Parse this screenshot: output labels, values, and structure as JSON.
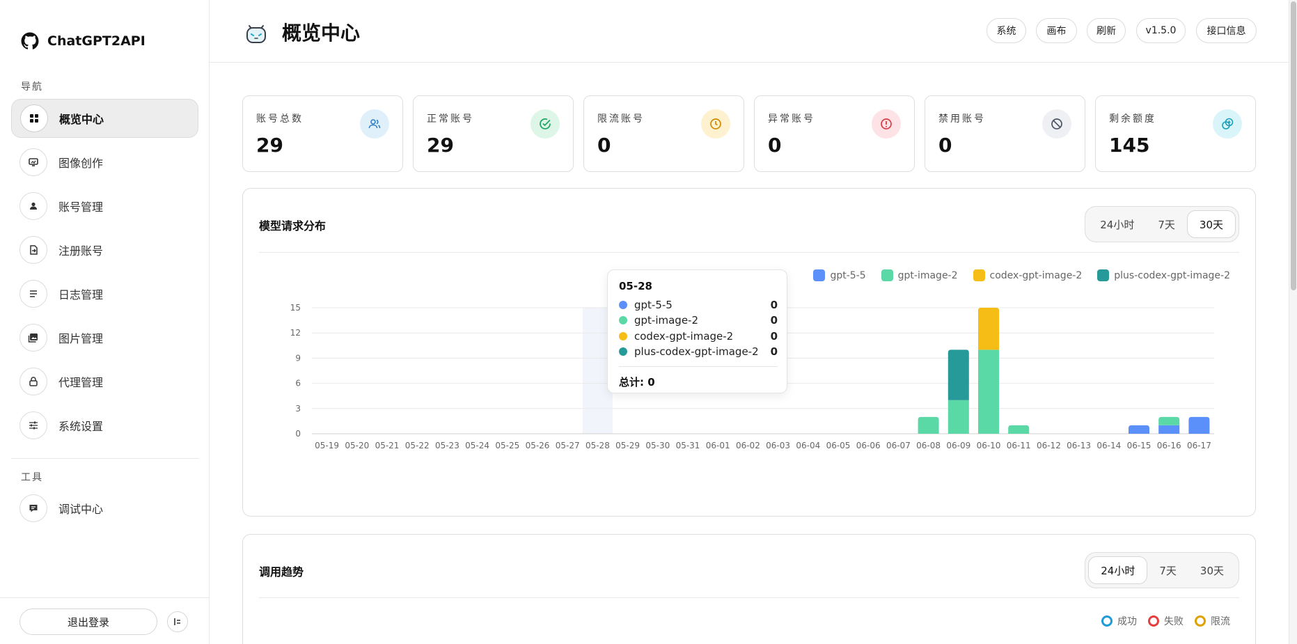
{
  "app": {
    "name": "ChatGPT2API"
  },
  "sidebar": {
    "nav_section": "导航",
    "items": [
      {
        "label": "概览中心",
        "active": true
      },
      {
        "label": "图像创作"
      },
      {
        "label": "账号管理"
      },
      {
        "label": "注册账号"
      },
      {
        "label": "日志管理"
      },
      {
        "label": "图片管理"
      },
      {
        "label": "代理管理"
      },
      {
        "label": "系统设置"
      }
    ],
    "tools_section": "工具",
    "tools": [
      {
        "label": "调试中心"
      }
    ],
    "logout": "退出登录"
  },
  "header": {
    "title": "概览中心",
    "buttons": [
      "系统",
      "画布",
      "刷新",
      "v1.5.0",
      "接口信息"
    ]
  },
  "stats": [
    {
      "label": "账号总数",
      "value": "29",
      "icon": "users-icon",
      "color": "#2f7fc6",
      "bg": "#dff0fb"
    },
    {
      "label": "正常账号",
      "value": "29",
      "icon": "check-circle-icon",
      "color": "#1fa463",
      "bg": "#ddf6e8"
    },
    {
      "label": "限流账号",
      "value": "0",
      "icon": "clock-icon",
      "color": "#d08a00",
      "bg": "#fdf1cf"
    },
    {
      "label": "异常账号",
      "value": "0",
      "icon": "alert-circle-icon",
      "color": "#d93a45",
      "bg": "#fde3e5"
    },
    {
      "label": "禁用账号",
      "value": "0",
      "icon": "ban-icon",
      "color": "#4b5563",
      "bg": "#eef0f4"
    },
    {
      "label": "剩余额度",
      "value": "145",
      "icon": "quota-icon",
      "color": "#1aa0b8",
      "bg": "#d9f5f9"
    }
  ],
  "panel1": {
    "title": "模型请求分布",
    "ranges": [
      "24小时",
      "7天",
      "30天"
    ],
    "active_range": "30天"
  },
  "panel2": {
    "title": "调用趋势",
    "ranges": [
      "24小时",
      "7天",
      "30天"
    ],
    "active_range": "24小时",
    "legend": [
      {
        "name": "成功",
        "color": "#1f9bd6"
      },
      {
        "name": "失败",
        "color": "#e53e3e"
      },
      {
        "name": "限流",
        "color": "#e0a100"
      }
    ]
  },
  "tooltip": {
    "date": "05-28",
    "rows": [
      {
        "name": "gpt-5-5",
        "value": "0"
      },
      {
        "name": "gpt-image-2",
        "value": "0"
      },
      {
        "name": "codex-gpt-image-2",
        "value": "0"
      },
      {
        "name": "plus-codex-gpt-image-2",
        "value": "0"
      }
    ],
    "total": "总计: 0"
  },
  "chart_data": {
    "type": "bar",
    "stacked": true,
    "categories": [
      "05-19",
      "05-20",
      "05-21",
      "05-22",
      "05-23",
      "05-24",
      "05-25",
      "05-26",
      "05-27",
      "05-28",
      "05-29",
      "05-30",
      "05-31",
      "06-01",
      "06-02",
      "06-03",
      "06-04",
      "06-05",
      "06-06",
      "06-07",
      "06-08",
      "06-09",
      "06-10",
      "06-11",
      "06-12",
      "06-13",
      "06-14",
      "06-15",
      "06-16",
      "06-17"
    ],
    "series": [
      {
        "name": "gpt-5-5",
        "color": "#5b8ff9",
        "values": [
          0,
          0,
          0,
          0,
          0,
          0,
          0,
          0,
          0,
          0,
          0,
          0,
          0,
          0,
          0,
          0,
          0,
          0,
          0,
          0,
          0,
          0,
          0,
          0,
          0,
          0,
          0,
          1,
          1,
          2
        ]
      },
      {
        "name": "gpt-image-2",
        "color": "#5ad8a6",
        "values": [
          0,
          0,
          0,
          0,
          0,
          0,
          0,
          0,
          0,
          0,
          0,
          0,
          0,
          0,
          0,
          0,
          0,
          0,
          0,
          0,
          2,
          4,
          10,
          1,
          0,
          0,
          0,
          0,
          1,
          0
        ]
      },
      {
        "name": "codex-gpt-image-2",
        "color": "#f6bd16",
        "values": [
          0,
          0,
          0,
          0,
          0,
          0,
          0,
          0,
          0,
          0,
          0,
          0,
          0,
          0,
          0,
          0,
          0,
          0,
          0,
          0,
          0,
          0,
          5,
          0,
          0,
          0,
          0,
          0,
          0,
          0
        ]
      },
      {
        "name": "plus-codex-gpt-image-2",
        "color": "#269a99",
        "values": [
          0,
          0,
          0,
          0,
          0,
          0,
          0,
          0,
          0,
          0,
          0,
          0,
          0,
          0,
          0,
          0,
          0,
          0,
          0,
          0,
          0,
          6,
          0,
          0,
          0,
          0,
          0,
          0,
          0,
          0
        ]
      }
    ],
    "yticks": [
      0,
      3,
      6,
      9,
      12,
      15
    ],
    "ylim": [
      0,
      15
    ],
    "grid": true,
    "legend": "top-right",
    "highlight": "05-28"
  }
}
